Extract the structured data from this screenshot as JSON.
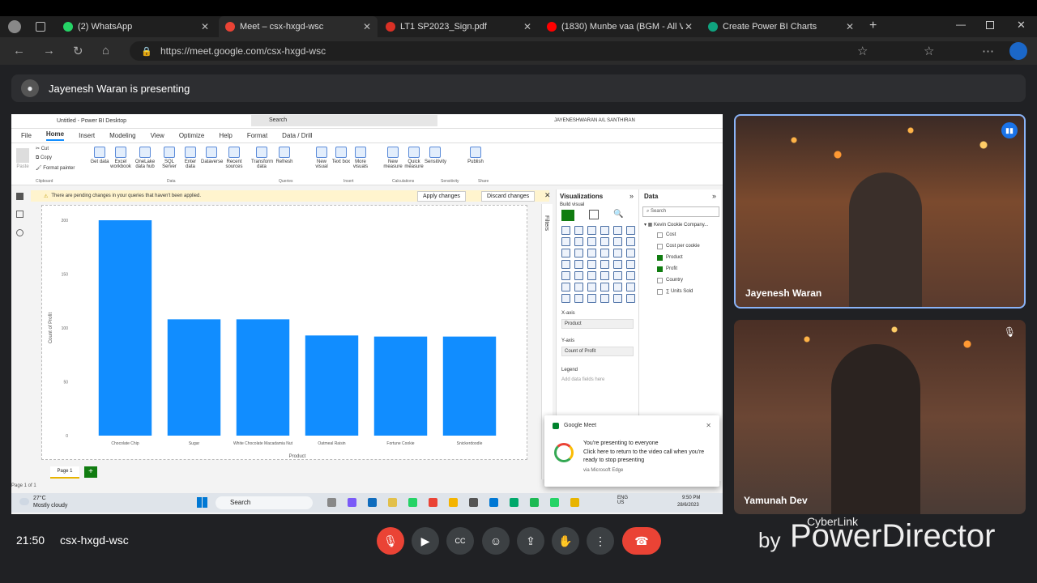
{
  "browser": {
    "tabs": [
      {
        "label": "(2) WhatsApp",
        "color": "#25d366"
      },
      {
        "label": "Meet – csx-hxgd-wsc",
        "color": "#ea4335"
      },
      {
        "label": "LT1 SP2023_Sign.pdf",
        "color": "#d93025"
      },
      {
        "label": "(1830) Munbe vaa (BGM - All Ver",
        "color": "#ff0000"
      },
      {
        "label": "Create Power BI Charts",
        "color": "#10a37f"
      }
    ],
    "url": "https://meet.google.com/csx-hxgd-wsc"
  },
  "meet": {
    "presenting_text": "Jayenesh Waran is presenting",
    "time": "21:50",
    "meeting_code": "csx-hxgd-wsc",
    "participants": [
      {
        "name": "Jayenesh Waran"
      },
      {
        "name": "Yamunah Dev"
      }
    ],
    "watermark_by": "by",
    "watermark_brand": "PowerDirector",
    "watermark_maker": "CyberLink"
  },
  "pbi": {
    "title": "Untitled - Power BI Desktop",
    "search": "Search",
    "user": "JAYENESHWARAN A/L SANTHIRAN",
    "menu": [
      "File",
      "Home",
      "Insert",
      "Modeling",
      "View",
      "Optimize",
      "Help",
      "Format",
      "Data / Drill"
    ],
    "ribbon": [
      {
        "label": "Get data"
      },
      {
        "label": "Excel workbook"
      },
      {
        "label": "OneLake data hub"
      },
      {
        "label": "SQL Server"
      },
      {
        "label": "Enter data"
      },
      {
        "label": "Dataverse"
      },
      {
        "label": "Recent sources"
      },
      {
        "label": "Transform data"
      },
      {
        "label": "Refresh"
      },
      {
        "label": "New visual"
      },
      {
        "label": "Text box"
      },
      {
        "label": "More visuals"
      },
      {
        "label": "New measure"
      },
      {
        "label": "Quick measure"
      },
      {
        "label": "Sensitivity"
      },
      {
        "label": "Publish"
      }
    ],
    "ribbon_groups": [
      "Clipboard",
      "Data",
      "Queries",
      "Insert",
      "Calculations",
      "Sensitivity",
      "Share"
    ],
    "clipboard": {
      "paste": "Paste",
      "cut": "Cut",
      "copy": "Copy",
      "format_painter": "Format painter"
    },
    "pending_text": "There are pending changes in your queries that haven't been applied.",
    "apply_btn": "Apply changes",
    "discard_btn": "Discard changes",
    "filters_label": "Filters",
    "viz_title": "Visualizations",
    "build_visual": "Build visual",
    "data_title": "Data",
    "data_search": "Search",
    "table_name": "Kevin Cookie Company...",
    "fields": [
      {
        "name": "Cost",
        "checked": false
      },
      {
        "name": "Cost per cookie",
        "checked": false
      },
      {
        "name": "Product",
        "checked": true
      },
      {
        "name": "Profit",
        "checked": true
      },
      {
        "name": "Country",
        "checked": false
      },
      {
        "name": "∑ Units Sold",
        "checked": false
      }
    ],
    "xaxis_label": "X-axis",
    "xaxis_field": "Product",
    "yaxis_label": "Y-axis",
    "yaxis_field": "Count of Profit",
    "legend_label": "Legend",
    "legend_placeholder": "Add data fields here",
    "page_tab": "Page 1",
    "page_count": "Page 1 of 1"
  },
  "chart_data": {
    "type": "bar",
    "categories": [
      "Chocolate Chip",
      "Sugar",
      "White Chocolate Macadamia Nut",
      "Oatmeal Raisin",
      "Fortune Cookie",
      "Snickerdoodle"
    ],
    "values": [
      200,
      108,
      108,
      93,
      92,
      92
    ],
    "xlabel": "Product",
    "ylabel": "Count of Profit",
    "ylim": [
      0,
      200
    ],
    "yticks": [
      0,
      50,
      100,
      150,
      200
    ],
    "color": "#118dff"
  },
  "toast": {
    "app": "Google Meet",
    "line1": "You're presenting to everyone",
    "line2": "Click here to return to the video call when you're ready to stop presenting",
    "via": "via Microsoft Edge"
  },
  "taskbar": {
    "weather_temp": "27°C",
    "weather_desc": "Mostly cloudy",
    "search": "Search",
    "lang": "ENG\nUS",
    "clock_time": "9:50 PM",
    "clock_date": "28/6/2023"
  }
}
